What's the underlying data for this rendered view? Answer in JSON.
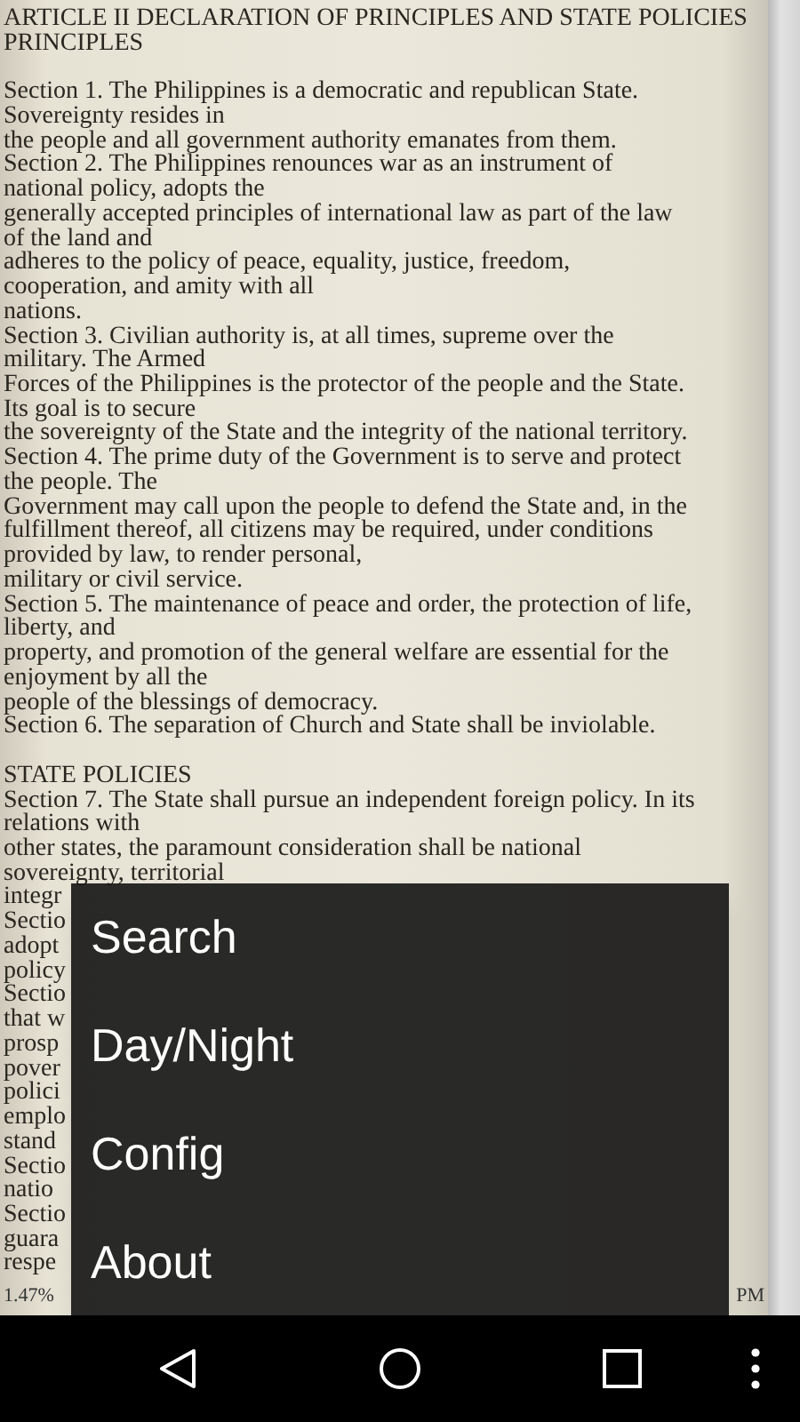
{
  "document": {
    "lines": [
      {
        "kind": "text",
        "text": "ARTICLE II DECLARATION OF PRINCIPLES AND STATE POLICIES"
      },
      {
        "kind": "text",
        "text": "PRINCIPLES"
      },
      {
        "kind": "blank"
      },
      {
        "kind": "text",
        "text": "Section 1. The Philippines is a democratic and republican State."
      },
      {
        "kind": "text",
        "text": "Sovereignty resides in"
      },
      {
        "kind": "text",
        "text": "the people and all government authority emanates from them."
      },
      {
        "kind": "text",
        "text": "Section 2. The Philippines renounces war as an instrument of"
      },
      {
        "kind": "text",
        "text": "national policy, adopts the"
      },
      {
        "kind": "text",
        "text": "generally accepted principles of international law as part of the law"
      },
      {
        "kind": "text",
        "text": "of the land and"
      },
      {
        "kind": "text",
        "text": "adheres to the policy of peace, equality, justice, freedom,"
      },
      {
        "kind": "text",
        "text": "cooperation, and amity with all"
      },
      {
        "kind": "text",
        "text": "nations."
      },
      {
        "kind": "text",
        "text": "Section 3. Civilian authority is, at all times, supreme over the"
      },
      {
        "kind": "text",
        "text": "military. The Armed"
      },
      {
        "kind": "text",
        "text": "Forces of the Philippines is the protector of the people and the State."
      },
      {
        "kind": "text",
        "text": "Its goal is to secure"
      },
      {
        "kind": "text",
        "text": "the sovereignty of the State and the integrity of the national territory."
      },
      {
        "kind": "text",
        "text": "Section 4. The prime duty of the Government is to serve and protect"
      },
      {
        "kind": "text",
        "text": "the people. The"
      },
      {
        "kind": "text",
        "text": "Government may call upon the people to defend the State and, in the"
      },
      {
        "kind": "text",
        "text": "fulfillment thereof, all citizens may be required, under conditions"
      },
      {
        "kind": "text",
        "text": "provided by law, to render personal,"
      },
      {
        "kind": "text",
        "text": "military or civil service."
      },
      {
        "kind": "text",
        "text": "Section 5. The maintenance of peace and order, the protection of life,"
      },
      {
        "kind": "text",
        "text": "liberty, and"
      },
      {
        "kind": "text",
        "text": "property, and promotion of the general welfare are essential for the"
      },
      {
        "kind": "text",
        "text": "enjoyment by all the"
      },
      {
        "kind": "text",
        "text": "people of the blessings of democracy."
      },
      {
        "kind": "text",
        "text": "Section 6. The separation of Church and State shall be inviolable."
      },
      {
        "kind": "blank"
      },
      {
        "kind": "text",
        "text": "STATE POLICIES"
      },
      {
        "kind": "text",
        "text": "Section 7. The State shall pursue an independent foreign policy. In its"
      },
      {
        "kind": "text",
        "text": "relations with"
      },
      {
        "kind": "text",
        "text": "other states, the paramount consideration shall be national"
      },
      {
        "kind": "text",
        "text": "sovereignty, territorial"
      },
      {
        "kind": "text",
        "text": "integr"
      },
      {
        "kind": "text",
        "text": "Sectio"
      },
      {
        "kind": "text",
        "text": "adopt"
      },
      {
        "kind": "text",
        "text": "policy"
      },
      {
        "kind": "text",
        "text": "Sectio"
      },
      {
        "kind": "text",
        "text": "that w"
      },
      {
        "kind": "text",
        "text": "prosp"
      },
      {
        "kind": "text",
        "text": "pover"
      },
      {
        "kind": "text",
        "text": "polici"
      },
      {
        "kind": "text",
        "text": "emplo"
      },
      {
        "kind": "text",
        "text": "stand"
      },
      {
        "kind": "text",
        "text": "Sectio"
      },
      {
        "kind": "text",
        "text": "natio"
      },
      {
        "kind": "text",
        "text": "Sectio"
      },
      {
        "kind": "text",
        "text": "guara"
      },
      {
        "kind": "text",
        "text": "respe"
      }
    ]
  },
  "status": {
    "progress": "1.47%",
    "time": "PM"
  },
  "menu": {
    "items": [
      "Search",
      "Day/Night",
      "Config",
      "About"
    ]
  }
}
